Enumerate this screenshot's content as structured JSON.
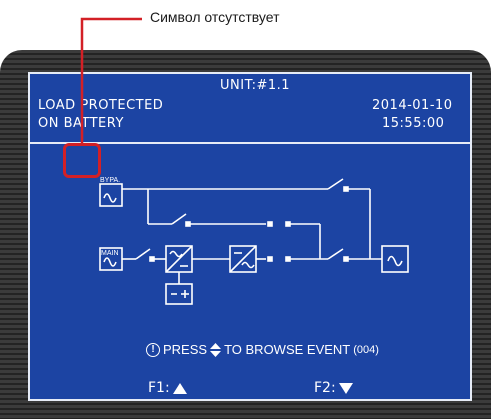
{
  "annotation": {
    "label": "Символ отсутствует",
    "color": "#d32026"
  },
  "screen": {
    "unit_label": "UNIT:#1.1",
    "status_line1": "LOAD PROTECTED",
    "status_line2": "ON BATTERY",
    "date": "2014-01-10",
    "time": "15:55:00",
    "bypass_label": "BYPA.",
    "main_label": "MAIN",
    "press_prefix": "PRESS",
    "press_suffix": "TO BROWSE EVENT",
    "event_count": "(004)",
    "f1_label": "F1:",
    "f2_label": "F2:",
    "background_color": "#1c44a3"
  }
}
